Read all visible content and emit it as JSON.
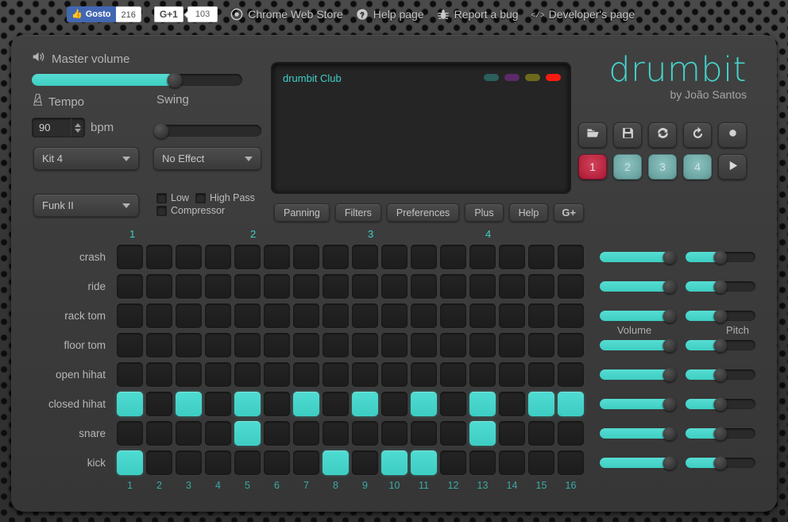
{
  "topbar": {
    "facebook": {
      "icon": "thumbs-up-icon",
      "label": "Gosto",
      "count": "216"
    },
    "gplus": {
      "label": "G+1",
      "count": "103"
    },
    "links": [
      {
        "icon": "chrome-icon",
        "label": "Chrome Web Store"
      },
      {
        "icon": "help-circle-icon",
        "label": "Help page"
      },
      {
        "icon": "bug-icon",
        "label": "Report a bug"
      },
      {
        "icon": "code-icon",
        "label": "Developer's page"
      }
    ]
  },
  "master": {
    "icon": "speaker-icon",
    "label": "Master volume",
    "value": 68
  },
  "tempo": {
    "icon": "metronome-icon",
    "label": "Tempo",
    "value": "90",
    "unit": "bpm"
  },
  "swing": {
    "label": "Swing",
    "value": 0
  },
  "selects": {
    "kit": {
      "value": "Kit 4",
      "icon": "chevron-down-icon"
    },
    "effect": {
      "value": "No Effect",
      "icon": "chevron-down-icon"
    },
    "pattern": {
      "value": "Funk II",
      "icon": "chevron-down-icon"
    }
  },
  "filters": [
    {
      "label": "Low",
      "checked": false
    },
    {
      "label": "High Pass",
      "checked": false
    },
    {
      "label": "Compressor",
      "checked": false
    }
  ],
  "display": {
    "title": "drumbit Club",
    "leds": [
      {
        "name": "led-teal",
        "color": "#2a5f5c"
      },
      {
        "name": "led-purple",
        "color": "#5c2a68"
      },
      {
        "name": "led-olive",
        "color": "#6e6a1d"
      },
      {
        "name": "led-red",
        "color": "#f71c13"
      }
    ]
  },
  "function_buttons": [
    {
      "name": "panning",
      "label": "Panning"
    },
    {
      "name": "filters",
      "label": "Filters"
    },
    {
      "name": "preferences",
      "label": "Preferences"
    },
    {
      "name": "plus",
      "label": "Plus"
    },
    {
      "name": "help",
      "label": "Help"
    },
    {
      "name": "gplus",
      "label": "G+"
    }
  ],
  "logo": {
    "main": "drumbit",
    "sub": "by João Santos",
    "color": "#43d3cb"
  },
  "transport": {
    "tools": [
      {
        "name": "open-icon",
        "label": "open"
      },
      {
        "name": "save-icon",
        "label": "save"
      },
      {
        "name": "refresh-icon",
        "label": "refresh"
      },
      {
        "name": "undo-icon",
        "label": "undo"
      },
      {
        "name": "record-icon",
        "label": "record"
      }
    ],
    "patterns": [
      {
        "label": "1",
        "state": "active"
      },
      {
        "label": "2",
        "state": "dim"
      },
      {
        "label": "3",
        "state": "dim"
      },
      {
        "label": "4",
        "state": "dim"
      }
    ],
    "play": {
      "name": "play-icon",
      "label": "play"
    }
  },
  "sequencer": {
    "beat_marks": [
      "1",
      "2",
      "3",
      "4"
    ],
    "step_numbers": [
      "1",
      "2",
      "3",
      "4",
      "5",
      "6",
      "7",
      "8",
      "9",
      "10",
      "11",
      "12",
      "13",
      "14",
      "15",
      "16"
    ],
    "active_color": "#3ecdc3",
    "slider_labels": {
      "volume": "Volume",
      "pitch": "Pitch"
    },
    "tracks": [
      {
        "name": "crash",
        "label": "crash",
        "steps": [
          0,
          0,
          0,
          0,
          0,
          0,
          0,
          0,
          0,
          0,
          0,
          0,
          0,
          0,
          0,
          0
        ],
        "volume": 100,
        "pitch": 50
      },
      {
        "name": "ride",
        "label": "ride",
        "steps": [
          0,
          0,
          0,
          0,
          0,
          0,
          0,
          0,
          0,
          0,
          0,
          0,
          0,
          0,
          0,
          0
        ],
        "volume": 100,
        "pitch": 50
      },
      {
        "name": "rack-tom",
        "label": "rack tom",
        "steps": [
          0,
          0,
          0,
          0,
          0,
          0,
          0,
          0,
          0,
          0,
          0,
          0,
          0,
          0,
          0,
          0
        ],
        "volume": 100,
        "pitch": 50
      },
      {
        "name": "floor-tom",
        "label": "floor tom",
        "steps": [
          0,
          0,
          0,
          0,
          0,
          0,
          0,
          0,
          0,
          0,
          0,
          0,
          0,
          0,
          0,
          0
        ],
        "volume": 100,
        "pitch": 50
      },
      {
        "name": "open-hihat",
        "label": "open hihat",
        "steps": [
          0,
          0,
          0,
          0,
          0,
          0,
          0,
          0,
          0,
          0,
          0,
          0,
          0,
          0,
          0,
          0
        ],
        "volume": 100,
        "pitch": 50
      },
      {
        "name": "closed-hihat",
        "label": "closed hihat",
        "steps": [
          1,
          0,
          1,
          0,
          1,
          0,
          1,
          0,
          1,
          0,
          1,
          0,
          1,
          0,
          1,
          1
        ],
        "volume": 100,
        "pitch": 50
      },
      {
        "name": "snare",
        "label": "snare",
        "steps": [
          0,
          0,
          0,
          0,
          1,
          0,
          0,
          0,
          0,
          0,
          0,
          0,
          1,
          0,
          0,
          0
        ],
        "volume": 100,
        "pitch": 50
      },
      {
        "name": "kick",
        "label": "kick",
        "steps": [
          1,
          0,
          0,
          0,
          0,
          0,
          0,
          1,
          0,
          1,
          1,
          0,
          0,
          0,
          0,
          0
        ],
        "volume": 100,
        "pitch": 50
      }
    ]
  }
}
